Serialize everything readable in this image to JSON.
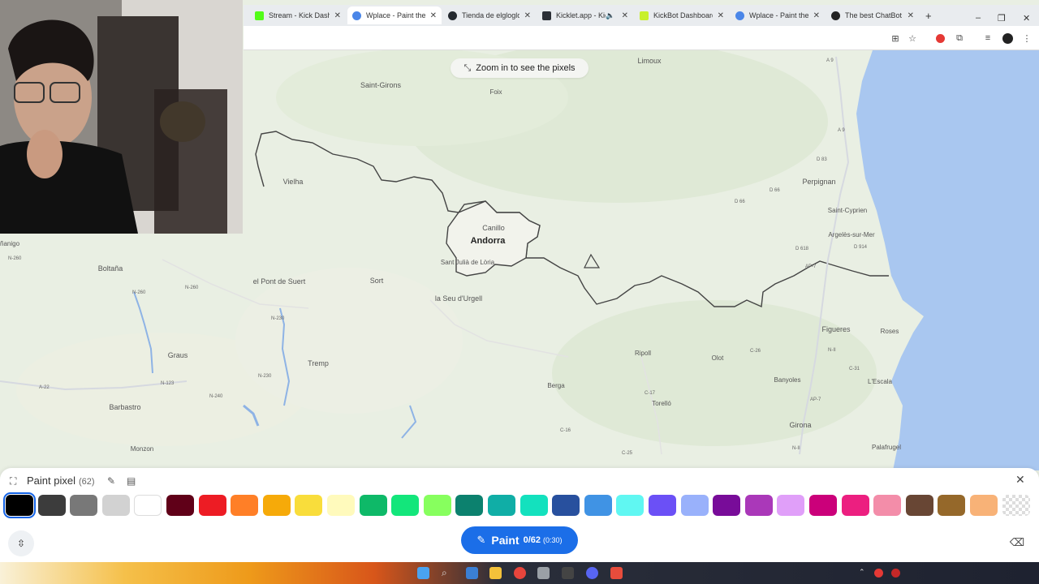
{
  "browser": {
    "tabs": [
      {
        "title": "Stream - Kick Dashb",
        "favicon_color": "#53fc18",
        "active": false
      },
      {
        "title": "Wplace - Paint the w",
        "favicon_color": "#4a86e8",
        "active": true
      },
      {
        "title": "Tienda de elglogloli",
        "favicon_color": "#24292f",
        "active": false
      },
      {
        "title": "Kicklet.app - Kic",
        "favicon_color": "#2b2f36",
        "active": false,
        "audio": true
      },
      {
        "title": "KickBot Dashboard",
        "favicon_color": "#c8f02c",
        "active": false
      },
      {
        "title": "Wplace - Paint the w",
        "favicon_color": "#4a86e8",
        "active": false
      },
      {
        "title": "The best ChatBot a",
        "favicon_color": "#222",
        "active": false
      }
    ],
    "new_tab_label": "+",
    "window_controls": {
      "minimize": "–",
      "restore": "❐",
      "close": "✕"
    },
    "toolbar_icons": [
      "install-icon",
      "star-icon",
      "adblock-icon",
      "extensions-icon",
      "media-icon",
      "profile-icon",
      "menu-icon"
    ]
  },
  "map": {
    "banner": "Zoom in to see the pixels",
    "places": {
      "limoux": "Limoux",
      "saint_girons": "Saint-Girons",
      "foix": "Foix",
      "vielha": "Vielha",
      "canillo": "Canillo",
      "andorra": "Andorra",
      "sant_julia": "Sant Julià de Lòria",
      "el_pont_de_suert": "el Pont de Suert",
      "sort": "Sort",
      "la_seu": "la Seu d'Urgell",
      "perpignan": "Perpignan",
      "saint_cyprien": "Saint-Cyprien",
      "argeles": "Argelès-sur-Mer",
      "figueres": "Figueres",
      "roses": "Roses",
      "ripoll": "Ripoll",
      "olot": "Olot",
      "banyoles": "Banyoles",
      "lescala": "L'Escala",
      "girona": "Girona",
      "palafrugell": "Palafrugel",
      "tremp": "Tremp",
      "graus": "Graus",
      "boltana": "Boltaña",
      "barbastro": "Barbastro",
      "monzon": "Monzon",
      "berga": "Berga",
      "torello": "Torelló",
      "sabinanigo": "ñanigo"
    },
    "roads": {
      "a9_top": "A 9",
      "a9_mid": "A 9",
      "d83": "D 83",
      "d66a": "D 66",
      "d66b": "D 66",
      "d618": "D 618",
      "d914": "D 914",
      "ap7a": "AP-7",
      "ap7b": "AP-7",
      "n260a": "N-260",
      "n260b": "N-260",
      "n260c": "N-260",
      "n230a": "N-230",
      "n230b": "N-230",
      "a22": "A-22",
      "n123": "N-123",
      "n240": "N-240",
      "c17": "C-17",
      "c16": "C-16",
      "c25": "C-25",
      "c26": "C-26",
      "n2": "N-II",
      "c31": "C-31",
      "n2b": "N-II"
    }
  },
  "panel": {
    "title": "Paint pixel",
    "count": "(62)",
    "colors": [
      "#000000",
      "#3c3c3c",
      "#787878",
      "#d2d2d2",
      "#ffffff",
      "#600018",
      "#ed1c24",
      "#ff7f27",
      "#f6aa09",
      "#f9dd3b",
      "#fffabc",
      "#0eb968",
      "#13e67b",
      "#87ff5e",
      "#0c816e",
      "#10aea6",
      "#13e1be",
      "#28509e",
      "#4093e4",
      "#60f7f2",
      "#6b50f6",
      "#99b1fb",
      "#780c99",
      "#aa38b9",
      "#e09ff9",
      "#cb007a",
      "#ec1f80",
      "#f38da9",
      "#684634",
      "#95682a",
      "#f8b277",
      "transparent"
    ],
    "selected_index": 0,
    "paint_button": {
      "label": "Paint",
      "count": "0/62",
      "timer": "(0:30)"
    }
  },
  "taskbar": {
    "icons": [
      "windows-icon",
      "search-icon",
      "calendar-icon",
      "explorer-icon",
      "chrome-icon",
      "settings-icon",
      "gmail-icon",
      "discord-icon",
      "app-icon"
    ],
    "tray": [
      "chevron-up-icon",
      "antivirus-icon",
      "shield-icon"
    ]
  }
}
